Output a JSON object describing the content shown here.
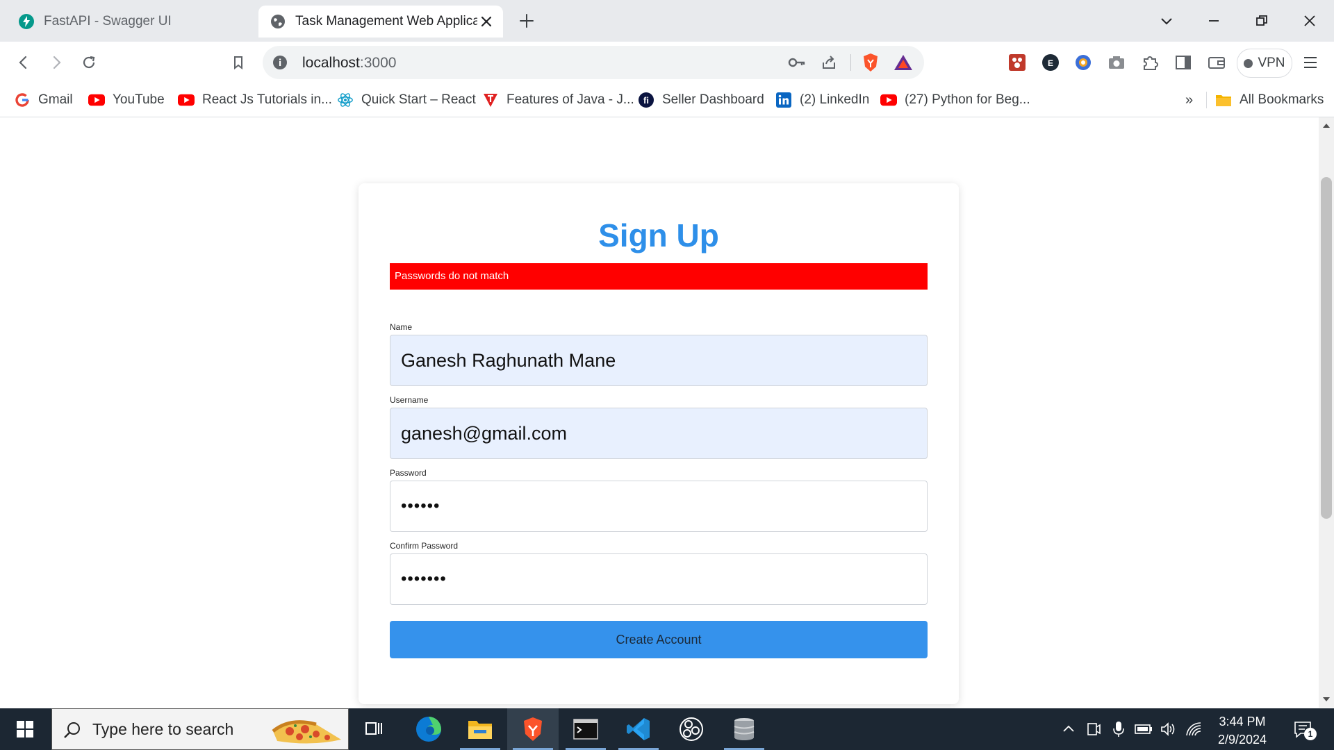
{
  "browser": {
    "tabs": [
      {
        "title": "FastAPI - Swagger UI",
        "active": false,
        "icon": "fastapi-icon"
      },
      {
        "title": "Task Management Web Application",
        "active": true,
        "icon": "globe-icon"
      }
    ],
    "address": {
      "host": "localhost",
      "port": ":3000"
    },
    "vpn_label": "VPN",
    "bookmarks": [
      {
        "label": "Gmail",
        "icon": "google-icon"
      },
      {
        "label": "YouTube",
        "icon": "youtube-icon"
      },
      {
        "label": "React Js Tutorials in...",
        "icon": "youtube-icon"
      },
      {
        "label": "Quick Start – React",
        "icon": "react-icon"
      },
      {
        "label": "Features of Java - J...",
        "icon": "tpoint-icon"
      },
      {
        "label": "Seller Dashboard",
        "icon": "flipkart-icon"
      },
      {
        "label": "(2) LinkedIn",
        "icon": "linkedin-icon"
      },
      {
        "label": "(27) Python for Beg...",
        "icon": "youtube-icon"
      }
    ],
    "all_bookmarks_label": "All Bookmarks",
    "overflow_label": "»"
  },
  "page": {
    "title": "Sign Up",
    "error_message": "Passwords do not match",
    "fields": {
      "name": {
        "label": "Name",
        "value": "Ganesh Raghunath Mane"
      },
      "username": {
        "label": "Username",
        "value": "ganesh@gmail.com"
      },
      "password": {
        "label": "Password",
        "value": "••••••"
      },
      "confirm_password": {
        "label": "Confirm Password",
        "value": "•••••••"
      }
    },
    "submit_label": "Create Account"
  },
  "taskbar": {
    "search_placeholder": "Type here to search",
    "time": "3:44 PM",
    "date": "2/9/2024",
    "notification_count": "1"
  },
  "colors": {
    "brand_blue": "#2e8fe9",
    "button_blue": "#3592ec",
    "error_red": "#ff0000",
    "autofill_bg": "#e8f0fe"
  }
}
